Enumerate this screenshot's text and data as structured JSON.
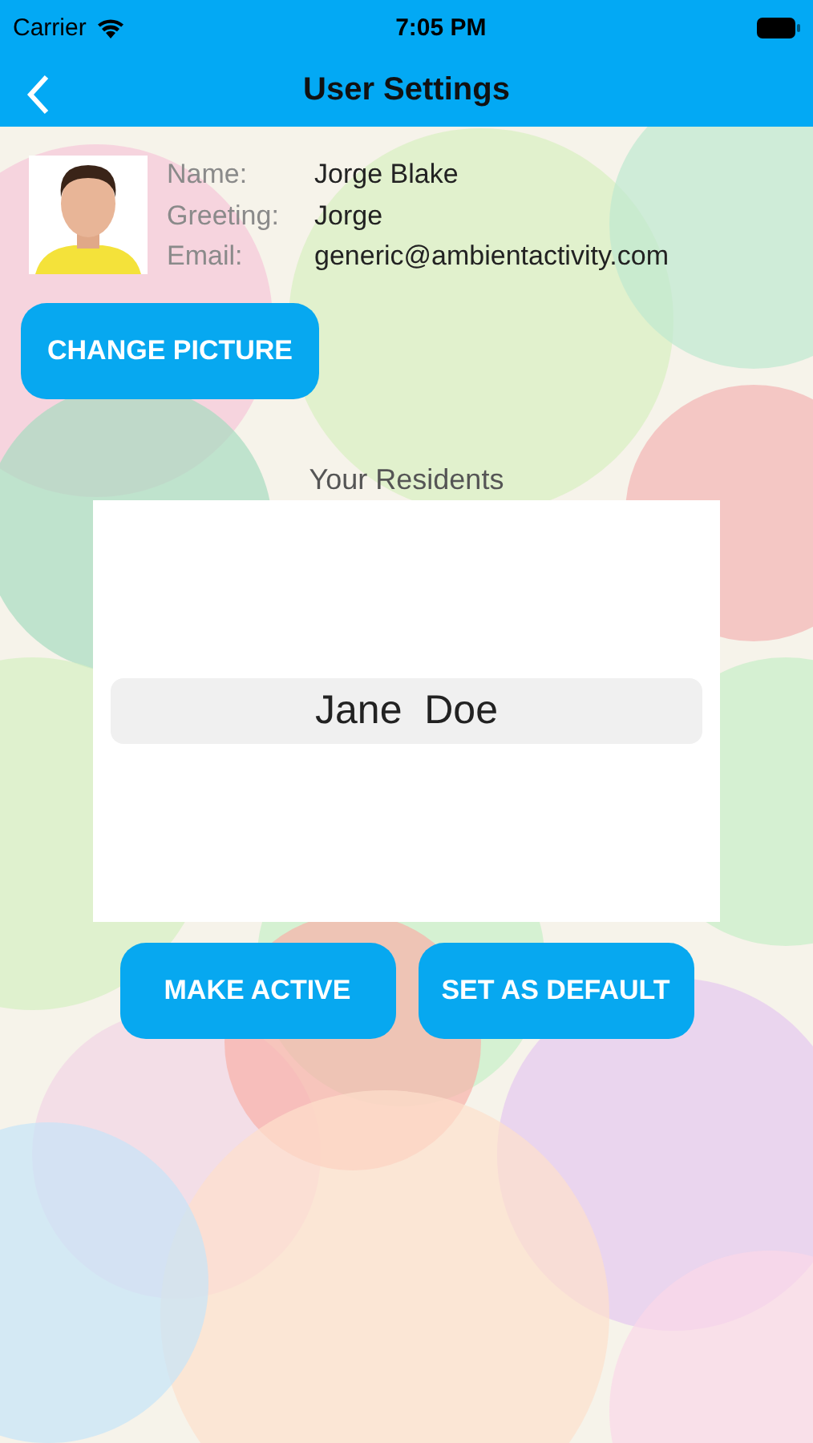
{
  "status_bar": {
    "carrier": "Carrier",
    "time": "7:05 PM"
  },
  "nav_bar": {
    "title": "User Settings"
  },
  "profile": {
    "fields": [
      {
        "label": "Name:",
        "value": "Jorge Blake"
      },
      {
        "label": "Greeting:",
        "value": "Jorge"
      },
      {
        "label": "Email:",
        "value": "generic@ambientactivity.com"
      }
    ]
  },
  "change_picture_button": "CHANGE PICTURE",
  "residents": {
    "title": "Your Residents",
    "items": [
      {
        "name": "Jane  Doe",
        "selected": true
      }
    ]
  },
  "buttons": [
    "MAKE ACTIVE",
    "SET AS DEFAULT"
  ]
}
